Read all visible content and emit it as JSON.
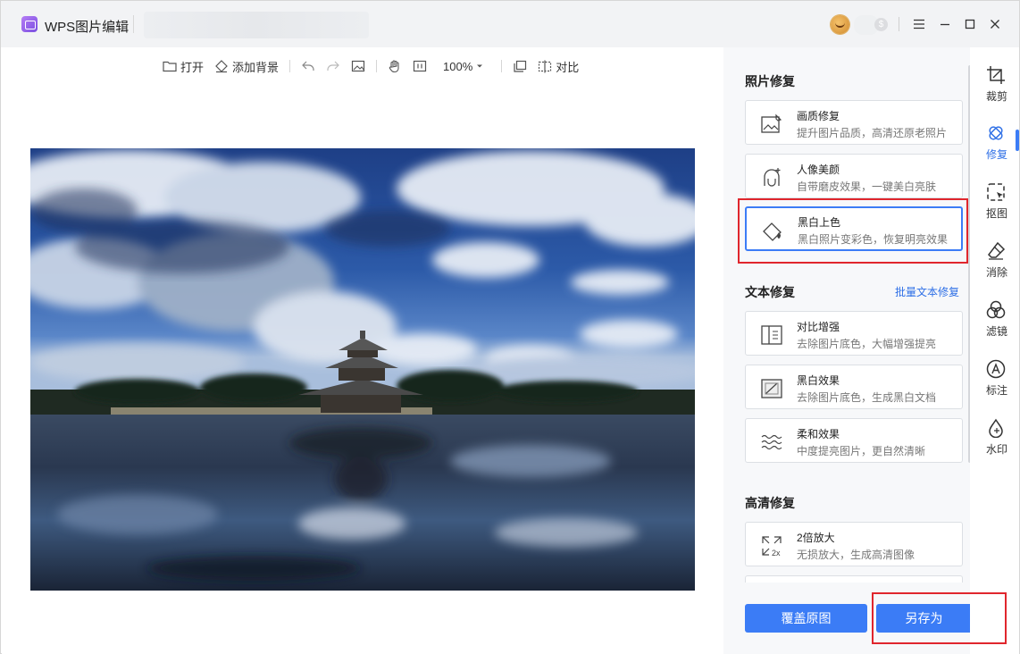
{
  "app": {
    "title": "WPS图片编辑",
    "logo_icon": "image-edit-logo-icon"
  },
  "window_controls": [
    "menu-icon",
    "minimize-icon",
    "maximize-icon",
    "close-icon"
  ],
  "toolbar": {
    "open": "打开",
    "add_background": "添加背景",
    "zoom": "100%",
    "compare": "对比"
  },
  "panel": {
    "photo_repair": {
      "title": "照片修复",
      "items": [
        {
          "title": "画质修复",
          "desc": "提升图片品质，高清还原老照片",
          "icon": "image-quality-icon"
        },
        {
          "title": "人像美颜",
          "desc": "自带磨皮效果，一键美白亮肤",
          "icon": "portrait-beauty-icon"
        },
        {
          "title": "黑白上色",
          "desc": "黑白照片变彩色，恢复明亮效果",
          "icon": "paint-bucket-icon",
          "active": true
        }
      ]
    },
    "text_repair": {
      "title": "文本修复",
      "batch_link": "批量文本修复",
      "items": [
        {
          "title": "对比增强",
          "desc": "去除图片底色，大幅增强提亮",
          "icon": "contrast-enhance-icon"
        },
        {
          "title": "黑白效果",
          "desc": "去除图片底色，生成黑白文档",
          "icon": "bw-effect-icon"
        },
        {
          "title": "柔和效果",
          "desc": "中度提亮图片，更自然清晰",
          "icon": "soft-effect-icon"
        }
      ]
    },
    "hd_repair": {
      "title": "高清修复",
      "items": [
        {
          "title": "2倍放大",
          "desc": "无损放大，生成高清图像",
          "icon": "upscale-2x-icon"
        }
      ]
    },
    "overwrite_button": "覆盖原图",
    "save_as_button": "另存为"
  },
  "rail": [
    {
      "label": "裁剪",
      "icon": "crop-icon"
    },
    {
      "label": "修复",
      "icon": "repair-icon",
      "active": true
    },
    {
      "label": "抠图",
      "icon": "cutout-icon"
    },
    {
      "label": "消除",
      "icon": "eraser-icon"
    },
    {
      "label": "滤镜",
      "icon": "filter-icon"
    },
    {
      "label": "标注",
      "icon": "annotate-icon"
    },
    {
      "label": "水印",
      "icon": "watermark-icon"
    }
  ],
  "colors": {
    "accent": "#3b7cf6",
    "highlight": "#e0262d"
  }
}
